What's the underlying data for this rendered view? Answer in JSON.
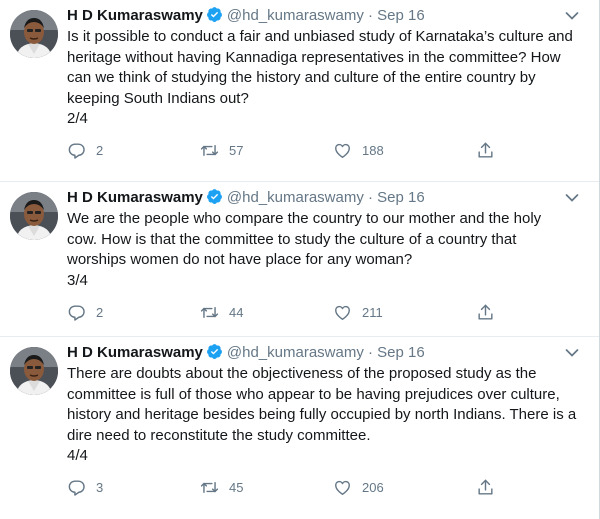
{
  "tweets": [
    {
      "author": {
        "name": "H D Kumaraswamy",
        "handle": "@hd_kumaraswamy",
        "date": "· Sep 16",
        "verified": true
      },
      "lines": [
        "Is it possible to conduct a fair and unbiased study of Karnataka’s culture and",
        "heritage without having Kannadiga representatives in the committee? How",
        "can we think of studying the history and culture of the entire country by",
        "keeping South Indians out?",
        "2/4"
      ],
      "stats": {
        "replies": "2",
        "retweets": "57",
        "likes": "188"
      }
    },
    {
      "author": {
        "name": "H D Kumaraswamy",
        "handle": "@hd_kumaraswamy",
        "date": "· Sep 16",
        "verified": true
      },
      "lines": [
        "We are the people who compare the country to our mother and the holy",
        "cow. How is that the committee to study the culture of a country that",
        "worships women do not have  place for any woman?",
        "3/4"
      ],
      "stats": {
        "replies": "2",
        "retweets": "44",
        "likes": "211"
      }
    },
    {
      "author": {
        "name": "H D Kumaraswamy",
        "handle": "@hd_kumaraswamy",
        "date": "· Sep 16",
        "verified": true
      },
      "lines": [
        "There are doubts about the objectiveness of the proposed study as the",
        "committee is full of those who appear to be having prejudices over culture,",
        "history and heritage besides being fully occupied by north Indians. There is a",
        "dire need to reconstitute the study committee.",
        "4/4"
      ],
      "stats": {
        "replies": "3",
        "retweets": "45",
        "likes": "206"
      }
    }
  ],
  "icons": {
    "reply": "speech-bubble-icon",
    "retweet": "retweet-arrows-icon",
    "like": "heart-icon",
    "share": "share-upload-icon",
    "more": "chevron-down-icon",
    "verified": "verified-badge-icon"
  },
  "colors": {
    "text": "#14171a",
    "muted": "#657786",
    "verified": "#1da1f2",
    "divider": "#e6ecf0"
  }
}
